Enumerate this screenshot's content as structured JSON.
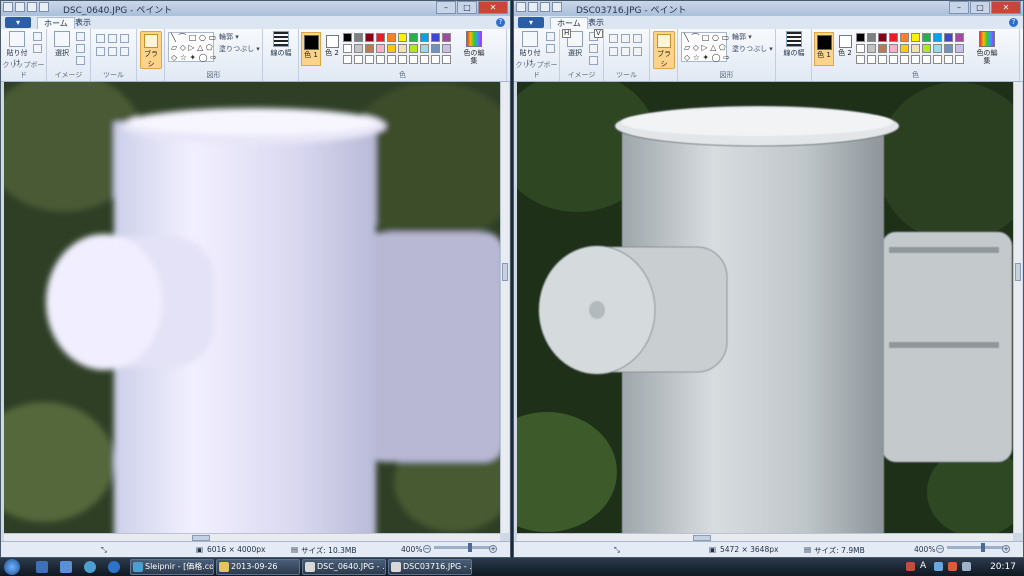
{
  "left_window": {
    "title": "DSC_0640.JPG - ペイント",
    "file_menu": "▾",
    "tabs": [
      "ホーム",
      "表示"
    ],
    "status": {
      "dimensions": "6016 × 4000px",
      "size": "サイズ: 10.3MB",
      "zoom": "400%"
    }
  },
  "right_window": {
    "title": "DSC03716.JPG - ペイント",
    "file_menu": "▾",
    "tabs": [
      "ホーム",
      "表示"
    ],
    "tab_keytips": [
      "H",
      "V"
    ],
    "status": {
      "dimensions": "5472 × 3648px",
      "size": "サイズ: 7.9MB",
      "zoom": "400%"
    }
  },
  "ribbon": {
    "paste": "貼り付け",
    "select": "選択",
    "brush": "ブラシ",
    "outline": "輪郭 ▾",
    "fill": "塗りつぶし ▾",
    "line_width": "線の幅",
    "color1": "色 1",
    "color2": "色 2",
    "edit_colors": "色の編集",
    "groups": {
      "clipboard": "クリップボード",
      "image": "イメージ",
      "tools": "ツール",
      "shapes": "図形",
      "colors": "色"
    }
  },
  "palette": [
    "#000000",
    "#7f7f7f",
    "#880015",
    "#ed1c24",
    "#ff7f27",
    "#fff200",
    "#22b14c",
    "#00a2e8",
    "#3f48cc",
    "#a349a4",
    "#ffffff",
    "#c3c3c3",
    "#b97a57",
    "#ffaec9",
    "#ffc90e",
    "#efe4b0",
    "#b5e61d",
    "#99d9ea",
    "#7092be",
    "#c8bfe7",
    "#ffffff",
    "#ffffff",
    "#ffffff",
    "#ffffff",
    "#ffffff",
    "#ffffff",
    "#ffffff",
    "#ffffff",
    "#ffffff",
    "#ffffff"
  ],
  "taskbar": {
    "items": [
      "Sleipnir - [価格.co...",
      "2013-09-26",
      "DSC_0640.JPG - ...",
      "DSC03716.JPG - ..."
    ],
    "clock": "20:17",
    "tray_label": "A"
  }
}
